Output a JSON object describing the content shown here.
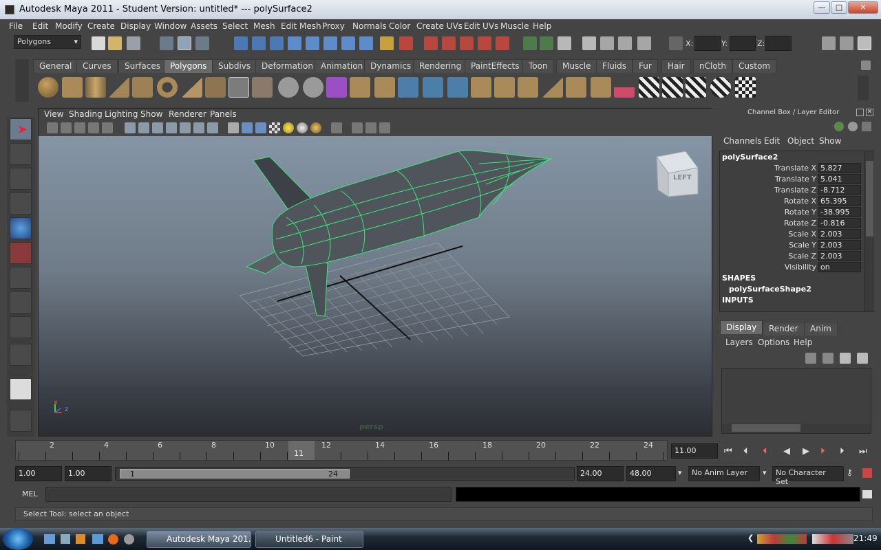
{
  "window": {
    "title": "Autodesk Maya 2011 - Student Version: untitled*   ---   polySurface2"
  },
  "menu": [
    "File",
    "Edit",
    "Modify",
    "Create",
    "Display",
    "Window",
    "Assets",
    "Select",
    "Mesh",
    "Edit Mesh",
    "Proxy",
    "Normals",
    "Color",
    "Create UVs",
    "Edit UVs",
    "Muscle",
    "Help"
  ],
  "status": {
    "mode": "Polygons",
    "x_label": "X:",
    "y_label": "Y:",
    "z_label": "Z:"
  },
  "shelf_tabs": [
    "General",
    "Curves",
    "Surfaces",
    "Polygons",
    "Subdivs",
    "Deformation",
    "Animation",
    "Dynamics",
    "Rendering",
    "PaintEffects",
    "Toon",
    "Muscle",
    "Fluids",
    "Fur",
    "Hair",
    "nCloth",
    "Custom"
  ],
  "shelf_active": "Polygons",
  "viewport": {
    "menu": [
      "View",
      "Shading",
      "Lighting",
      "Show",
      "Renderer",
      "Panels"
    ],
    "camera_label": "persp",
    "viewcube_label": "LEFT",
    "axis": {
      "x": "x",
      "y": "y",
      "z": "z"
    }
  },
  "channel_box": {
    "title": "Channel Box / Layer Editor",
    "menu": [
      "Channels",
      "Edit",
      "Object",
      "Show"
    ],
    "object": "polySurface2",
    "channels": [
      {
        "label": "Translate X",
        "value": "5.827"
      },
      {
        "label": "Translate Y",
        "value": "5.041"
      },
      {
        "label": "Translate Z",
        "value": "-8.712"
      },
      {
        "label": "Rotate X",
        "value": "65.395"
      },
      {
        "label": "Rotate Y",
        "value": "-38.995"
      },
      {
        "label": "Rotate Z",
        "value": "-0.816"
      },
      {
        "label": "Scale X",
        "value": "2.003"
      },
      {
        "label": "Scale Y",
        "value": "2.003"
      },
      {
        "label": "Scale Z",
        "value": "2.003"
      },
      {
        "label": "Visibility",
        "value": "on"
      }
    ],
    "shapes_header": "SHAPES",
    "shape_name": "polySurfaceShape2",
    "inputs_header": "INPUTS"
  },
  "layer_editor": {
    "tabs": [
      "Display",
      "Render",
      "Anim"
    ],
    "menu": [
      "Layers",
      "Options",
      "Help"
    ]
  },
  "timeline": {
    "ticks": [
      "2",
      "4",
      "6",
      "8",
      "10",
      "12",
      "14",
      "16",
      "18",
      "20",
      "22",
      "24"
    ],
    "current_frame": "11",
    "current_time": "11.00"
  },
  "range": {
    "start": "1.00",
    "playback_start": "1.00",
    "slider_start": "1",
    "slider_end": "24",
    "playback_end": "24.00",
    "end": "48.00",
    "anim_layer": "No Anim Layer",
    "character_set": "No Character Set"
  },
  "command": {
    "label": "MEL"
  },
  "help": {
    "text": "Select Tool: select an object"
  },
  "taskbar": {
    "items": [
      "Autodesk Maya 201...",
      "Untitled6 - Paint"
    ],
    "clock": "21:49"
  }
}
